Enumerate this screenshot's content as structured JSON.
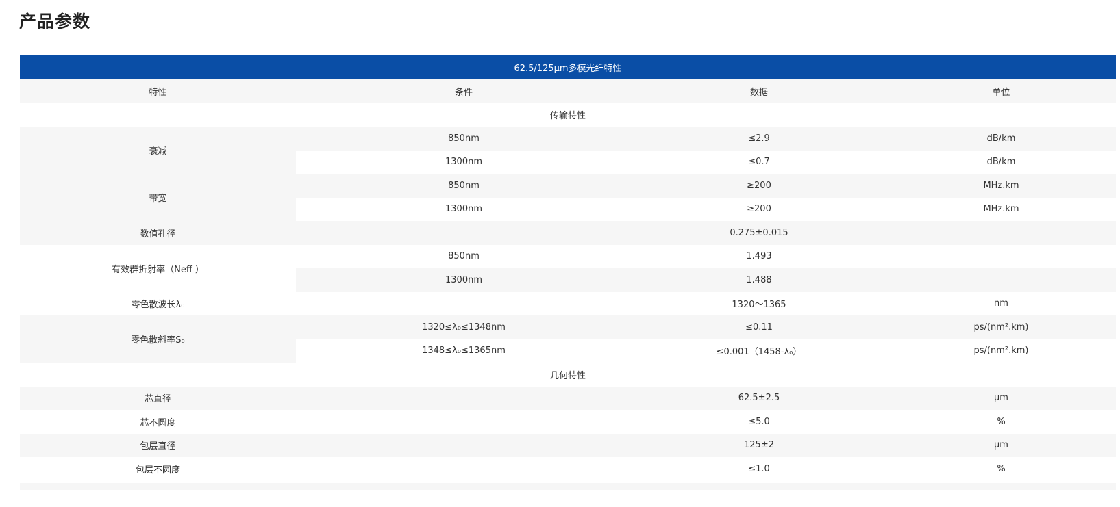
{
  "page_title": "产品参数",
  "table": {
    "title": "62.5/125μm多模光纤特性",
    "headers": [
      "特性",
      "条件",
      "数据",
      "单位"
    ],
    "sections": {
      "transmission": "传输特性",
      "geometry": "几何特性"
    },
    "rows": {
      "attenuation": {
        "label": "衰减",
        "r1": {
          "condition": "850nm",
          "value": "≤2.9",
          "unit": "dB/km"
        },
        "r2": {
          "condition": "1300nm",
          "value": "≤0.7",
          "unit": "dB/km"
        }
      },
      "bandwidth": {
        "label": "带宽",
        "r1": {
          "condition": "850nm",
          "value": "≥200",
          "unit": "MHz.km"
        },
        "r2": {
          "condition": "1300nm",
          "value": "≥200",
          "unit": "MHz.km"
        }
      },
      "na": {
        "label": "数值孔径",
        "value": "0.275±0.015"
      },
      "neff": {
        "label": "有效群折射率（Neff ）",
        "r1": {
          "condition": "850nm",
          "value": "1.493"
        },
        "r2": {
          "condition": "1300nm",
          "value": "1.488"
        }
      },
      "zero_wl": {
        "label": "零色散波长λ₀",
        "value": "1320～1365",
        "unit": "nm"
      },
      "zero_slope": {
        "label": "零色散斜率S₀",
        "r1": {
          "condition": "1320≤λ₀≤1348nm",
          "value": "≤0.11",
          "unit": "ps/(nm².km)"
        },
        "r2": {
          "condition": "1348≤λ₀≤1365nm",
          "value": "≤0.001（1458-λ₀）",
          "unit": "ps/(nm².km)"
        }
      },
      "core_diameter": {
        "label": "芯直径",
        "value": "62.5±2.5",
        "unit": "μm"
      },
      "core_noncircularity": {
        "label": "芯不圆度",
        "value": "≤5.0",
        "unit": "%"
      },
      "cladding_diameter": {
        "label": "包层直径",
        "value": "125±2",
        "unit": "μm"
      },
      "cladding_noncircularity": {
        "label": "包层不圆度",
        "value": "≤1.0",
        "unit": "%"
      }
    }
  }
}
